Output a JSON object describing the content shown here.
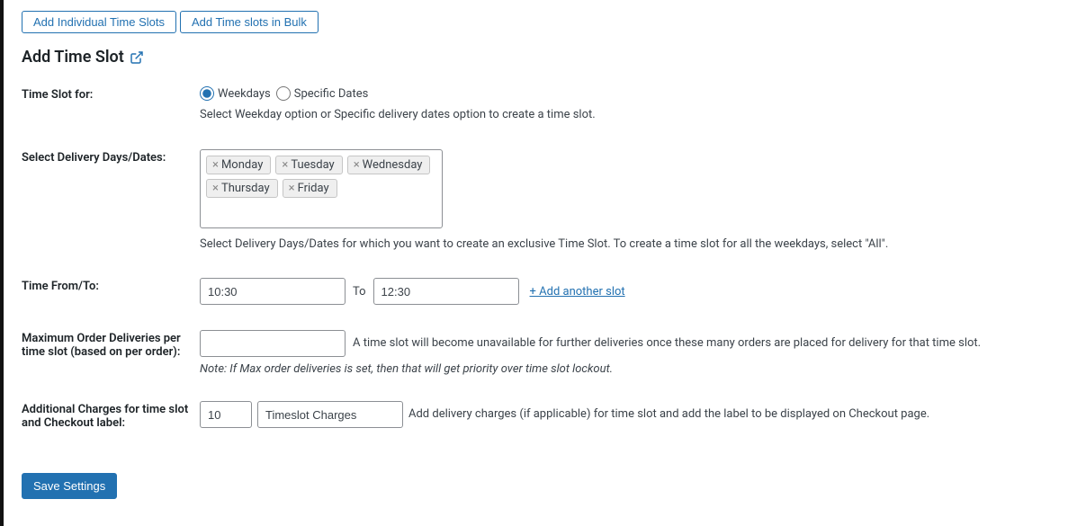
{
  "tabs": {
    "individual": "Add Individual Time Slots",
    "bulk": "Add Time slots in Bulk"
  },
  "section_title": "Add Time Slot",
  "time_slot_for": {
    "label": "Time Slot for:",
    "options": {
      "weekdays": "Weekdays",
      "specific_dates": "Specific Dates"
    },
    "help": "Select Weekday option or Specific delivery dates option to create a time slot."
  },
  "delivery_days": {
    "label": "Select Delivery Days/Dates:",
    "chips": [
      "Monday",
      "Tuesday",
      "Wednesday",
      "Thursday",
      "Friday"
    ],
    "help": "Select Delivery Days/Dates for which you want to create an exclusive Time Slot. To create a time slot for all the weekdays, select \"All\"."
  },
  "time_range": {
    "label": "Time From/To:",
    "from_value": "10:30",
    "to_label": "To",
    "to_value": "12:30",
    "add_link": "+ Add another slot"
  },
  "max_orders": {
    "label": "Maximum Order Deliveries per time slot (based on per order):",
    "value": "",
    "help": "A time slot will become unavailable for further deliveries once these many orders are placed for delivery for that time slot.",
    "note": "Note: If Max order deliveries is set, then that will get priority over time slot lockout."
  },
  "charges": {
    "label": "Additional Charges for time slot and Checkout label:",
    "amount": "10",
    "checkout_label": "Timeslot Charges",
    "help": "Add delivery charges (if applicable) for time slot and add the label to be displayed on Checkout page."
  },
  "save_button": "Save Settings"
}
